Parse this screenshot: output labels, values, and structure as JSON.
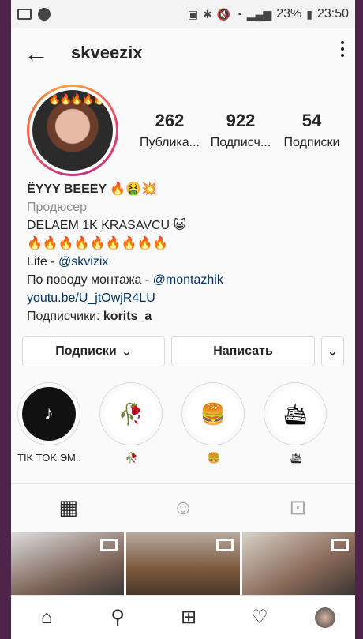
{
  "statusbar": {
    "battery": "23%",
    "time": "23:50"
  },
  "header": {
    "username": "skveezix",
    "back_icon": "arrow-left-icon",
    "more_icon": "more-vertical-icon"
  },
  "stats": [
    {
      "value": "262",
      "label": "Публика..."
    },
    {
      "value": "922",
      "label": "Подписч..."
    },
    {
      "value": "54",
      "label": "Подписки"
    }
  ],
  "bio": {
    "name": "ЁYYY BEEEY 🔥🤮💥",
    "category": "Продюсер",
    "line1": "DELAEM 1K KRASAVCU 😺",
    "line2": "🔥🔥🔥🔥🔥🔥🔥🔥🔥",
    "life_prefix": "Life - ",
    "life_link": "@skvizix",
    "montage_prefix": "По поводу монтажа - ",
    "montage_link": "@montazhik",
    "url": "youtu.be/U_jtOwjR4LU",
    "subs_prefix": "Подписчики: ",
    "subs_user": "korits_a"
  },
  "actions": {
    "subscriptions": "Подписки",
    "message": "Написать"
  },
  "highlights": [
    {
      "label": "TIK TOK ЭМ...",
      "icon": "♪"
    },
    {
      "label": "🥀",
      "icon": "🥀"
    },
    {
      "label": "🍔",
      "icon": "🍔"
    },
    {
      "label": "🛳",
      "icon": "🛳"
    }
  ],
  "tabs": [
    "grid-icon",
    "face-tag-icon",
    "tagged-person-icon"
  ],
  "bottom_nav": [
    "home-icon",
    "search-icon",
    "add-post-icon",
    "heart-icon",
    "profile-avatar"
  ]
}
